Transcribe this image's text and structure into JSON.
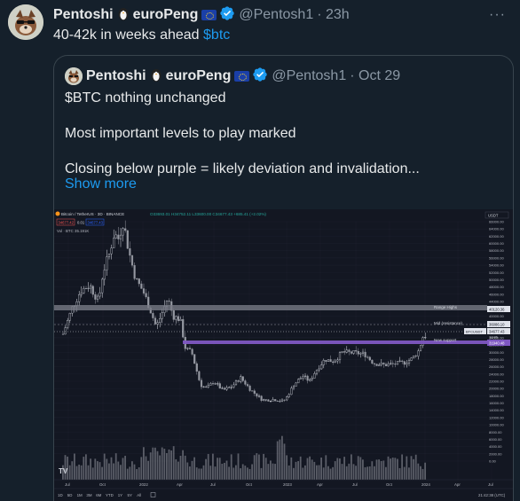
{
  "tweet": {
    "author_name": "Pentoshi",
    "author_suffix": "euroPeng",
    "handle": "@Pentosh1",
    "time": "· 23h",
    "text": "40-42k in weeks ahead",
    "cashtag": "$btc",
    "more_label": "···"
  },
  "quote": {
    "author_name": "Pentoshi",
    "author_suffix": "euroPeng",
    "handle": "@Pentosh1",
    "time": "· Oct 29",
    "lines": [
      "$BTC nothing unchanged",
      "Most important levels to play marked",
      "Closing below purple = likely deviation and invalidation..."
    ],
    "show_more": "Show more"
  },
  "chart": {
    "header": "Bitcoin / TetherUS · 3D · BINANCE",
    "ohlc": "O33693.01 H34752.11 L33600.00 C34677.43 +685.41 (+2.02%)",
    "sell_price": "34677.42",
    "spread": "0.01",
    "buy_price": "34677.43",
    "vol_label": "Vol · BTC  35.191K",
    "currency": "USDT",
    "timestamp": "21:42:38 (UTC)",
    "price_axis": [
      "66000.00",
      "64000.00",
      "62000.00",
      "60000.00",
      "58000.00",
      "56000.00",
      "54000.00",
      "52000.00",
      "50000.00",
      "48000.00",
      "46000.00",
      "44000.00",
      "42000.00",
      "40000.00",
      "38000.00",
      "36000.00",
      "34000.00",
      "32000.00",
      "30000.00",
      "28000.00",
      "26000.00",
      "24000.00",
      "22000.00",
      "20000.00",
      "18000.00",
      "16000.00",
      "14000.00",
      "12000.00",
      "10000.00",
      "8000.00",
      "6000.00",
      "4000.00",
      "2000.00",
      "0.00"
    ],
    "time_axis": [
      "Jul",
      "Oct",
      "2022",
      "Apr",
      "Jul",
      "Oct",
      "2023",
      "Apr",
      "Jul",
      "Oct",
      "2024",
      "Apr",
      "Jul"
    ],
    "range_buttons": [
      "1D",
      "5D",
      "1M",
      "3M",
      "6M",
      "YTD",
      "1Y",
      "5Y",
      "All"
    ],
    "levels": {
      "range_highs_label": "Range Highs",
      "range_highs_tag": "40120.36",
      "mid_label": "Mid (resistance)",
      "mid_tag": "36086.10",
      "btc_tag": "34677.43",
      "countdown": "1d 8h",
      "support_label": "New support",
      "support_tag": "31940.48"
    },
    "colors": {
      "background": "#131722",
      "candle": "#d1d4dc",
      "range_band": "#787b86",
      "support_band": "#7e57c2",
      "grid": "#1e2230"
    }
  }
}
